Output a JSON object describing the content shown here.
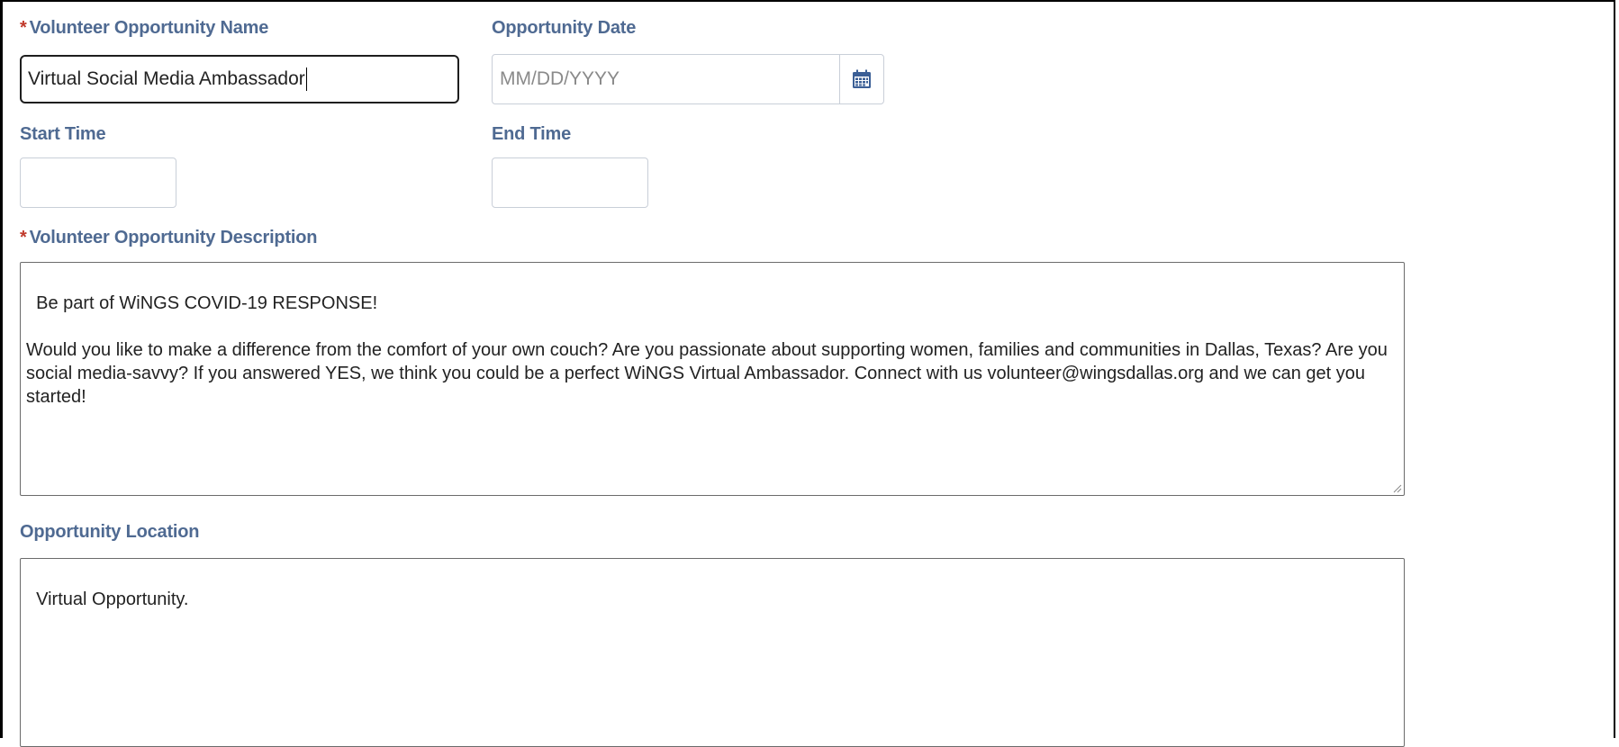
{
  "fields": {
    "opportunity_name": {
      "label": "Volunteer Opportunity Name",
      "required_marker": "*",
      "value": "Virtual Social Media Ambassador"
    },
    "opportunity_date": {
      "label": "Opportunity Date",
      "placeholder": "MM/DD/YYYY",
      "icon": "calendar-icon"
    },
    "start_time": {
      "label": "Start Time",
      "value": ""
    },
    "end_time": {
      "label": "End Time",
      "value": ""
    },
    "description": {
      "label": "Volunteer Opportunity Description",
      "required_marker": "*",
      "value": "Be part of WiNGS COVID-19 RESPONSE!\n\nWould you like to make a difference from the comfort of your own couch? Are you passionate about supporting women, families and communities in Dallas, Texas? Are you social media-savvy? If you answered YES, we think you could be a perfect WiNGS Virtual Ambassador. Connect with us volunteer@wingsdallas.org and we can get you started!"
    },
    "location": {
      "label": "Opportunity Location",
      "value": "Virtual Opportunity."
    }
  },
  "colors": {
    "label": "#4f6a92",
    "required": "#c0392b",
    "calendar_icon": "#3b5f96"
  }
}
